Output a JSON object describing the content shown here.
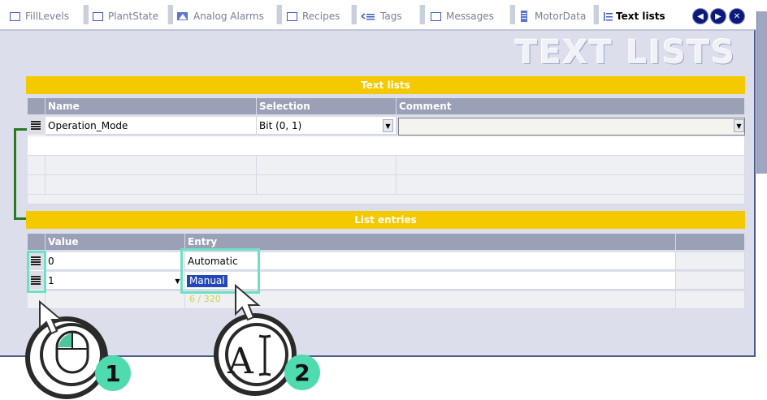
{
  "tabs": [
    {
      "label": "FillLevels",
      "icon": "window-icon"
    },
    {
      "label": "PlantState",
      "icon": "window-icon"
    },
    {
      "label": "Analog Alarms",
      "icon": "alarm-icon"
    },
    {
      "label": "Recipes",
      "icon": "window-icon"
    },
    {
      "label": "Tags",
      "icon": "tags-icon"
    },
    {
      "label": "Messages",
      "icon": "window-icon"
    },
    {
      "label": "MotorData",
      "icon": "list-icon"
    },
    {
      "label": "Text lists",
      "icon": "textlist-icon",
      "active": true
    }
  ],
  "nav": {
    "prev": "◀",
    "next": "▶",
    "close": "✕"
  },
  "page_title": "TEXT LISTS",
  "text_lists": {
    "title": "Text lists",
    "columns": [
      "Name",
      "Selection",
      "Comment"
    ],
    "rows": [
      {
        "name": "Operation_Mode",
        "selection": "Bit (0, 1)",
        "comment": ""
      }
    ]
  },
  "list_entries": {
    "title": "List entries",
    "columns": [
      "Value",
      "Entry"
    ],
    "rows": [
      {
        "value": "0",
        "entry": "Automatic"
      },
      {
        "value": "1",
        "entry": "Manual"
      }
    ],
    "char_counter": "6 / 320"
  },
  "callouts": [
    {
      "number": "1",
      "icon": "mouse-icon"
    },
    {
      "number": "2",
      "icon": "text-cursor-icon"
    }
  ],
  "colors": {
    "header_yellow": "#f5c900",
    "accent_mint": "#6fe0c3",
    "bracket_green": "#2b7a22",
    "selection_blue": "#2447b8"
  }
}
